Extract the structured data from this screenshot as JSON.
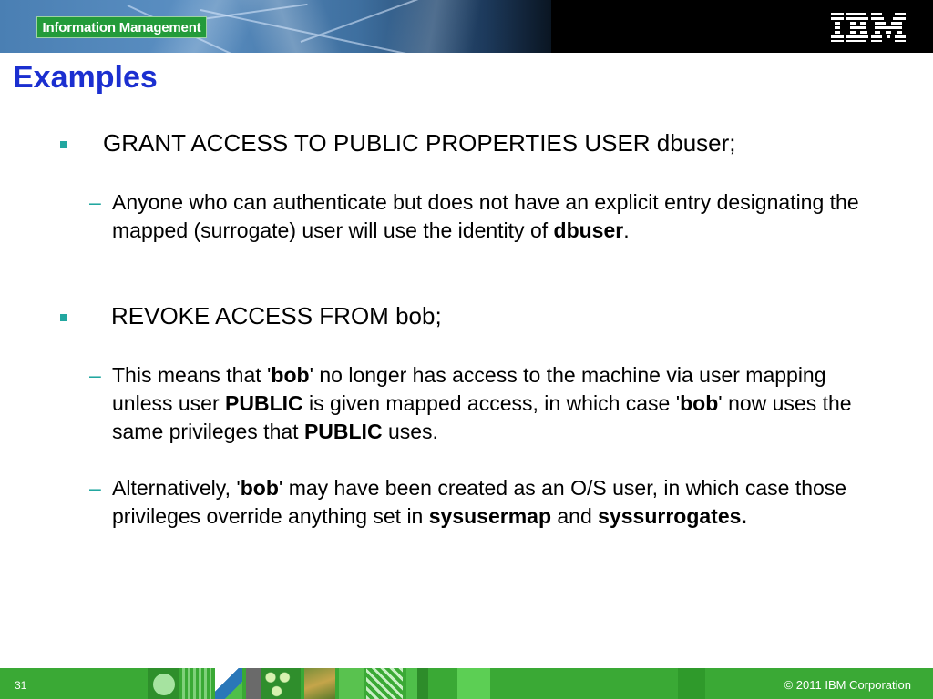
{
  "header": {
    "badge": "Information Management",
    "logo": "IBM"
  },
  "title": "Examples",
  "bullets": [
    {
      "text": "GRANT ACCESS TO PUBLIC PROPERTIES USER dbuser;",
      "subs": [
        {
          "segments": [
            "Anyone who can authenticate but does not have an explicit entry designating the mapped (surrogate) user will use the identity of ",
            "dbuser",
            "."
          ]
        }
      ]
    },
    {
      "text": "REVOKE ACCESS FROM bob;",
      "subs": [
        {
          "segments": [
            "This means that '",
            "bob",
            "' no longer has access to the machine via user mapping unless user ",
            "PUBLIC",
            " is given mapped access, in which case '",
            "bob",
            "' now uses the same privileges that ",
            "PUBLIC",
            " uses."
          ]
        },
        {
          "segments": [
            "Alternatively, '",
            "bob",
            "' may have been created as an O/S user, in which case those privileges override anything set in ",
            "sysusermap",
            " and ",
            "syssurrogates."
          ]
        }
      ]
    }
  ],
  "footer": {
    "page_number": "31",
    "copyright": "© 2011 IBM Corporation"
  },
  "colors": {
    "title": "#1b2fd0",
    "bullet_accent": "#22a7a0",
    "footer_green": "#3aa935",
    "badge_green": "#239b3a"
  }
}
